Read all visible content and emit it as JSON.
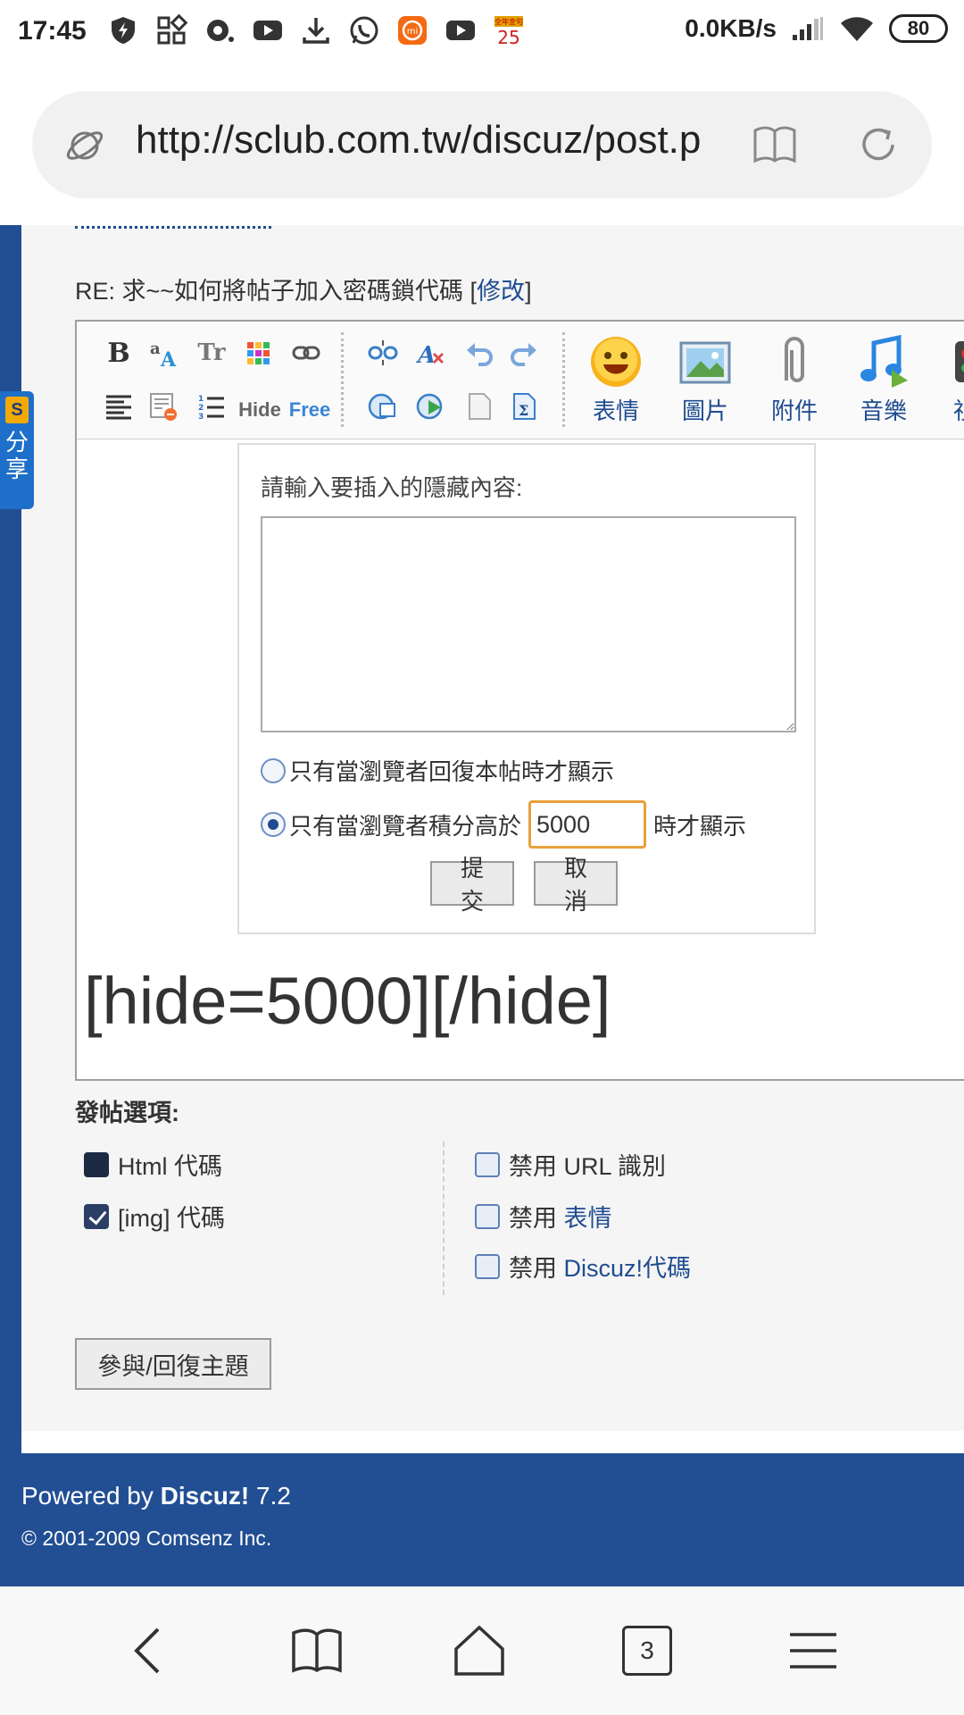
{
  "status_bar": {
    "time": "17:45",
    "net_speed": "0.0KB/s",
    "battery": "80",
    "calendar_day": "25",
    "calendar_title": "全年金句"
  },
  "browser": {
    "url": "http://sclub.com.tw/discuz/post.p",
    "tabs_count": "3"
  },
  "share_tab": {
    "logo": "S",
    "label": "分享"
  },
  "post": {
    "reply_title_prefix": "RE: 求~~如何將帖子加入密碼鎖代碼 [",
    "edit_link": "修改",
    "reply_title_suffix": "]"
  },
  "toolbar": {
    "bold": "B",
    "font_size": "Tr",
    "hide": "Hide",
    "free": "Free",
    "emoticon_label": "表情",
    "image_label": "圖片",
    "attach_label": "附件",
    "music_label": "音樂",
    "video_label": "視"
  },
  "hide_dialog": {
    "label": "請輸入要插入的隱藏內容:",
    "content_value": "",
    "option_reply": "只有當瀏覽者回復本帖時才顯示",
    "option_score_prefix": "只有當瀏覽者積分高於",
    "score_value": "5000",
    "option_score_suffix": "時才顯示",
    "selected_option": "score",
    "submit": "提交",
    "cancel": "取消"
  },
  "editor": {
    "content": "[hide=5000][/hide]"
  },
  "post_options": {
    "title": "發帖選項:",
    "html_code": "Html 代碼",
    "img_code": "[img] 代碼",
    "disable_url": "禁用 URL 識別",
    "disable_prefix": "禁用",
    "emoticons_link": "表情",
    "discuz_code_link": "Discuz!代碼",
    "html_checked": false,
    "img_checked": true
  },
  "submit_button": "參與/回復主題",
  "footer": {
    "powered_prefix": "Powered by",
    "brand": "Discuz!",
    "version": "7.2",
    "copyright": "© 2001-2009 Comsenz Inc."
  }
}
